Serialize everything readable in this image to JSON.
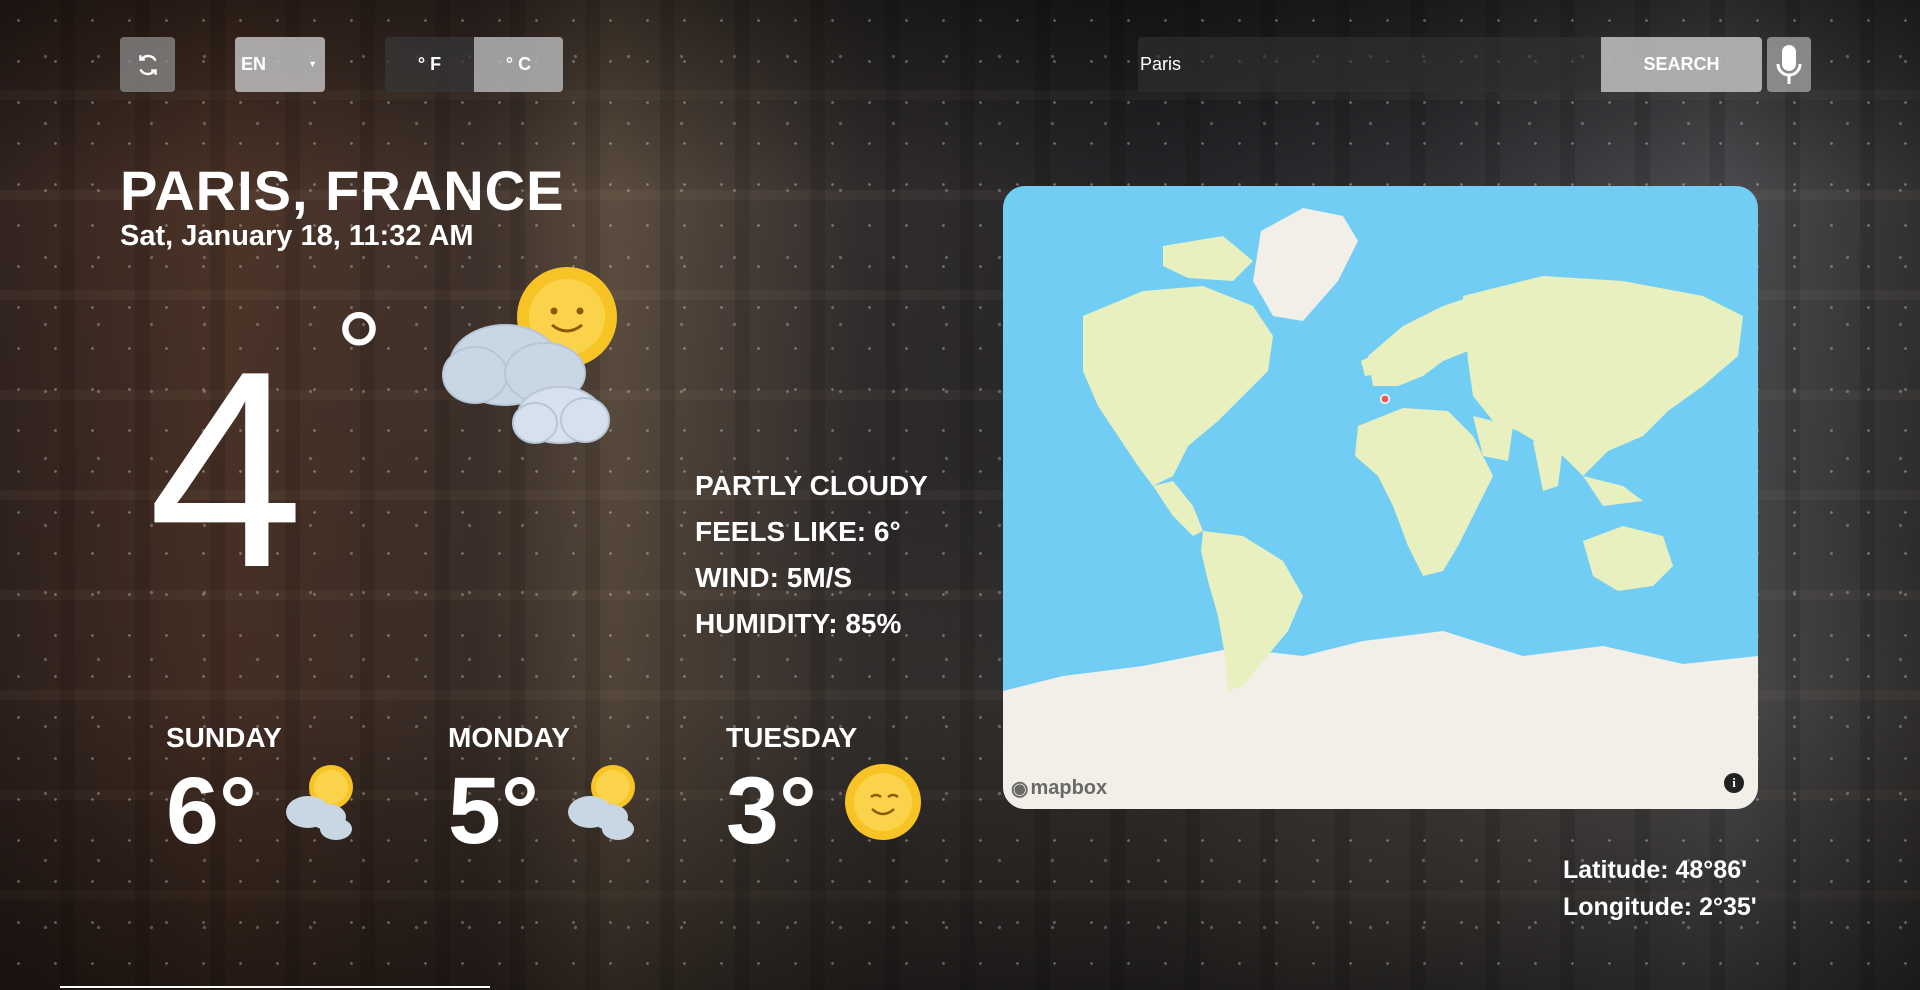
{
  "controls": {
    "refresh_icon": "refresh-icon",
    "language": {
      "selected": "EN"
    },
    "units": {
      "fahrenheit_label": "° F",
      "celsius_label": "° C",
      "active": "celsius"
    },
    "search": {
      "value": "Paris",
      "button_label": "SEARCH"
    },
    "mic_icon": "microphone-icon"
  },
  "location": {
    "city": "PARIS, FRANCE",
    "datetime": "Sat, January 18, 11:32 AM"
  },
  "current": {
    "temperature": "4",
    "degree_symbol": "°",
    "icon": "partly-cloudy-icon",
    "condition": "PARTLY CLOUDY",
    "feels_like": "FEELS LIKE: 6°",
    "wind": "WIND: 5M/S",
    "humidity": "HUMIDITY: 85%"
  },
  "forecast": [
    {
      "day": "SUNDAY",
      "temp": "6°",
      "icon": "partly-cloudy-icon"
    },
    {
      "day": "MONDAY",
      "temp": "5°",
      "icon": "partly-cloudy-icon"
    },
    {
      "day": "TUESDAY",
      "temp": "3°",
      "icon": "sunny-icon"
    }
  ],
  "map": {
    "attribution": "mapbox",
    "marker": "location-marker",
    "colors": {
      "water": "#72cdf4",
      "land": "#e8f0c0",
      "ice": "#f2efe9",
      "marker": "#e55e5e"
    }
  },
  "coordinates": {
    "latitude": "Latitude: 48°86'",
    "longitude": "Longitude: 2°35'"
  }
}
